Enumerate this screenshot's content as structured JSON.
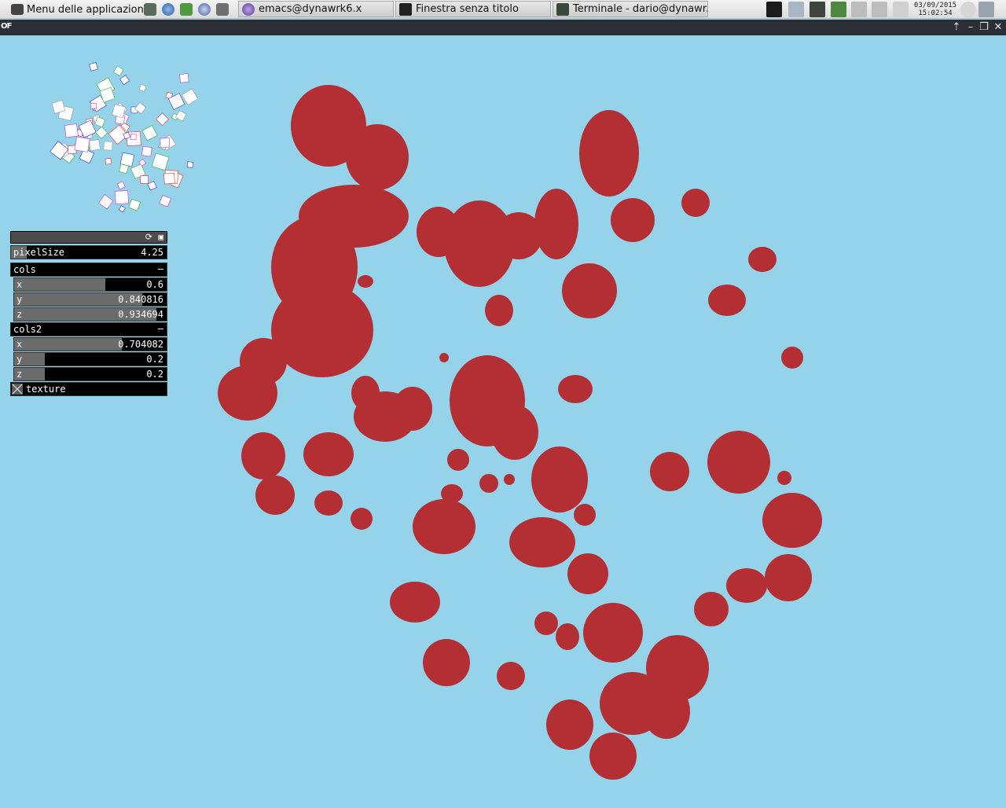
{
  "taskbar": {
    "menu_label": "Menu delle applicazioni",
    "tasks": [
      {
        "title": "emacs@dynawrk6.x"
      },
      {
        "title": "Finestra senza titolo"
      },
      {
        "title": "Terminale - dario@dynawr..."
      }
    ],
    "clock": {
      "date": "03/09/2015",
      "time": "15:02:54"
    }
  },
  "window": {
    "badge": "OF"
  },
  "gui": {
    "pixelSize": {
      "label": "pixelSize",
      "value": "4.25",
      "fraction": 0.1
    },
    "cols": {
      "title": "cols",
      "minimize": "–",
      "x": {
        "label": "x",
        "value": "0.6",
        "fraction": 0.6
      },
      "y": {
        "label": "y",
        "value": "0.840816",
        "fraction": 0.840816
      },
      "z": {
        "label": "z",
        "value": "0.934694",
        "fraction": 0.934694
      }
    },
    "cols2": {
      "title": "cols2",
      "minimize": "–",
      "x": {
        "label": "x",
        "value": "0.704082",
        "fraction": 0.704082
      },
      "y": {
        "label": "y",
        "value": "0.2",
        "fraction": 0.2
      },
      "z": {
        "label": "z",
        "value": "0.2",
        "fraction": 0.2
      }
    },
    "texture": {
      "label": "texture",
      "checked": false
    }
  },
  "colors": {
    "background": "#94d3ea",
    "blob": "#b42f33",
    "thumbnail": "#ffffff"
  }
}
